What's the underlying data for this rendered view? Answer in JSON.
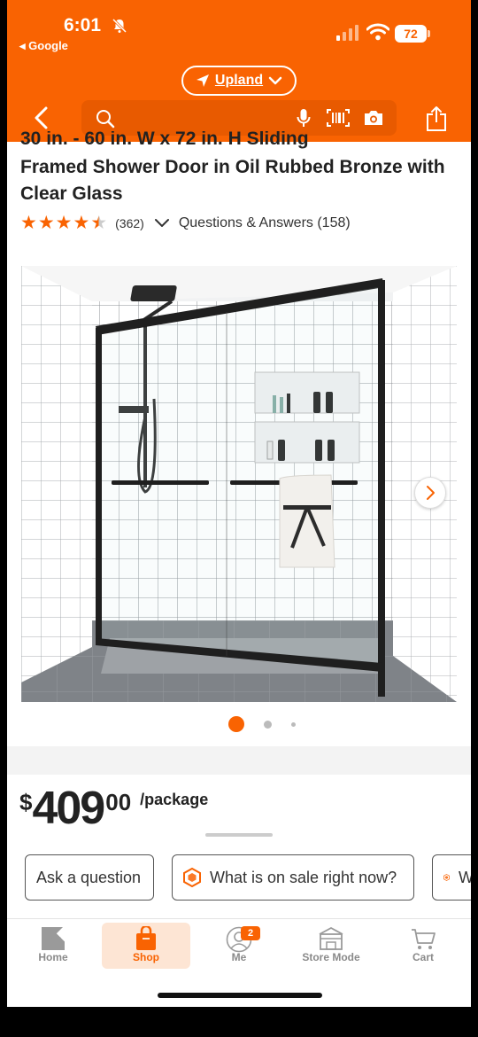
{
  "status_bar": {
    "time": "6:01",
    "back_app": "◂ Google",
    "battery": "72"
  },
  "header": {
    "location": "Upland",
    "search_placeholder": ""
  },
  "product": {
    "title_cut": "30 in. - 60 in. W x 72 in. H Sliding",
    "title": "Framed Shower Door in Oil Rubbed Bronze with Clear Glass",
    "rating": 4.5,
    "review_count": "(362)",
    "qa_label": "Questions & Answers (158)",
    "image_alt": "Sliding framed shower door with white tile walls"
  },
  "carousel": {
    "active_index": 0,
    "total": 3
  },
  "price": {
    "currency": "$",
    "dollars": "409",
    "cents": "00",
    "unit": "/package"
  },
  "chips": [
    {
      "label": "Ask a question",
      "icon": null
    },
    {
      "label": "What is on sale right now?",
      "icon": "hexagon-icon"
    },
    {
      "label": "W",
      "icon": "hexagon-icon"
    }
  ],
  "tabs": [
    {
      "label": "Home",
      "icon": "home-depot-logo-icon",
      "active": false
    },
    {
      "label": "Shop",
      "icon": "shopping-bag-icon",
      "active": true
    },
    {
      "label": "Me",
      "icon": "person-icon",
      "badge": "2",
      "active": false
    },
    {
      "label": "Store Mode",
      "icon": "store-icon",
      "active": false
    },
    {
      "label": "Cart",
      "icon": "cart-icon",
      "active": false
    }
  ],
  "colors": {
    "brand_orange": "#f96302",
    "tab_active_bg": "#fde5d4"
  }
}
